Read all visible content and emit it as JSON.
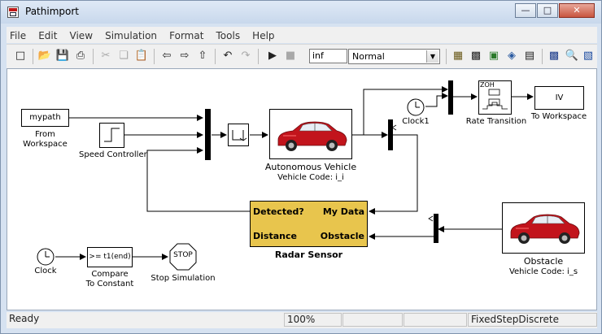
{
  "window": {
    "title": "Pathimport"
  },
  "window_controls": {
    "minimize": "—",
    "maximize": "□",
    "close": "✕"
  },
  "menu": [
    "File",
    "Edit",
    "View",
    "Simulation",
    "Format",
    "Tools",
    "Help"
  ],
  "toolbar": {
    "stop_time": "inf",
    "solver_mode": "Normal",
    "icons": [
      "new-icon",
      "open-icon",
      "save-icon",
      "print-icon",
      "cut-icon",
      "copy-icon",
      "paste-icon",
      "back-icon",
      "forward-icon",
      "up-icon",
      "undo-icon",
      "redo-icon",
      "play-icon",
      "stop-icon",
      "build-icon",
      "update-icon",
      "library-icon",
      "model-explorer-icon",
      "grid-icon",
      "debug-icon",
      "zoom-icon",
      "help-icon"
    ]
  },
  "blocks": {
    "mypath": "mypath",
    "from_workspace": "From\nWorkspace",
    "speed_controller": "Speed Controller",
    "autonomous_vehicle": "Autonomous Vehicle",
    "autonomous_vehicle_code": "Vehicle Code: i_i",
    "clock1": "Clock1",
    "zoh": "ZOH",
    "rate_transition": "Rate Transition",
    "to_workspace_value": "IV",
    "to_workspace": "To Workspace",
    "radar_detected": "Detected?",
    "radar_mydata": "My Data",
    "radar_distance": "Distance",
    "radar_obstacle": "Obstacle",
    "radar_sensor": "Radar Sensor",
    "obstacle": "Obstacle",
    "obstacle_code": "Vehicle Code: i_s",
    "clock": "Clock",
    "compare_value": ">= t1(end)",
    "compare_label": "Compare\nTo Constant",
    "stop_text": "STOP",
    "stop_simulation": "Stop Simulation"
  },
  "colors": {
    "radar_fill": "#e8c54d",
    "car_body": "#c2141c"
  },
  "status": {
    "state": "Ready",
    "zoom": "100%",
    "solver": "FixedStepDiscrete"
  }
}
